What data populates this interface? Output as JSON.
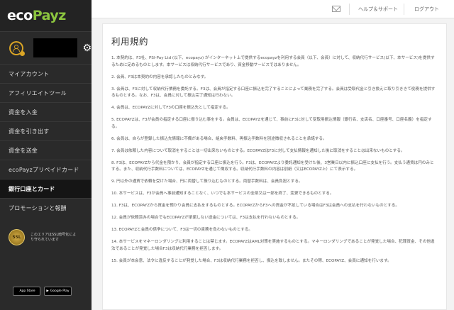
{
  "brand": {
    "logo_prefix": "eco",
    "logo_suffix": "Payz",
    "accent": "#8cc63f"
  },
  "sidebar": {
    "items": [
      {
        "label": "マイアカウント"
      },
      {
        "label": "アフィリエイトツール"
      },
      {
        "label": "資金を入金"
      },
      {
        "label": "資金を引き出す"
      },
      {
        "label": "資金を送金"
      },
      {
        "label": "ecoPayzプリペイドカード"
      },
      {
        "label": "銀行口座とカード",
        "active": true
      },
      {
        "label": "プロモーションと報酬"
      }
    ],
    "ssl_seal": "SSL",
    "ssl_text": "このエリアはSSL暗号化により守られています",
    "app_store": "App Store",
    "google_play": "Google Play"
  },
  "header": {
    "help_label": "ヘルプ＆サポート",
    "logout_label": "ログアウト"
  },
  "page": {
    "title": "利用規約",
    "terms": [
      "1. 本契約は、F3社、PSI-Pay Ltd (以下、ecopayz) がインターネット上で提供するecopayzを利用する会員（以下、会員）に対して、収納代行サービス(以下、本サービス)を提供するために定めるものとします。本サービスは収納代行サービスであり、資金移動サービスではありません。",
      "2. 会員、F3は本契約の内容を承認したものとみなす。",
      "3. 会員は、F3に対して収納代行債務を委託する。F3は、会員が指定する口座に振込を完了することによって業務を完了する。会員は受取代金と引き換えに取り引ききて役務を提供するものとする。なお、F3は、会員に対して振込完了通知は行わない。",
      "4. 会員は、ECOPAYZに対してF3の口座を振込先として指定する。",
      "5. ECOPAYZは、F3が会員の指定する口座に振り込む事をする。会員は、ECOPAYZを通じて、事前にF3に対して受取用振込情報（銀行名、支店名、口座番号、口座名義）を指定する。",
      "6. 会員は、自らが登録した振込先情報に不備がある場合、組戻手数料、再振込手数料を別途徴収されることを承諾する。",
      "7. 会員は依頼した内容について取消をすることは一切出来ないものとする。ECOPAYZはF3に対して支払情報を通知した後に取消をすることは出来ないものとする。",
      "8. F3は、ECOPAYZから代金を預かり、会員が指定する口座に振込を行う。F3は、ECOPAYZより委託通知を受けた後、3営業日以内に振込口座に支払を行う。支払う通貨は円のみとする。また、収納代行手数料については、ECOPAYZを通じて徴収する。収納代行手数料の内容は別紙（又はECOPAYZ上）にて表示する。",
      "9. 円以外の通貨で依頼を受けた場合、円に両替して振り込むものとする。両替手数料は、会員負担とする。",
      "10. 本サービスは、F3が会員へ事前通知することなく、いつでも本サービスの全部又は一部を終了、変更できるものとする。",
      "11. F3は、ECOPAYZから資金を預かり会員に支払をするものとする。ECOPAYZからF3への資金が不足している場合はF3は会員への支払を行わないものとする。",
      "12. 会員が依頼済みの場合でもECOPAYZが承諾しない送金については、F3は支払を行わないものとする。",
      "13. ECOPAYZと会員の係争について、F3は一切の責務を負わないものとする。",
      "14. 本サービスをマネーロンダリングに利用することは禁じます。ECOPAYZはAML対策を実施するものとする。マネーロンダリングであることが発覚した場合、犯罪資金、その他違法であることが発覚した場合F3は収納代行業務を拒否します。",
      "15. 会員が本会意、法令に違反することが発覚した場合、F3は収納代行業務を拒否し、振込を致しません。またその際、ECOPAYZ、会員に通知を行います。"
    ]
  }
}
